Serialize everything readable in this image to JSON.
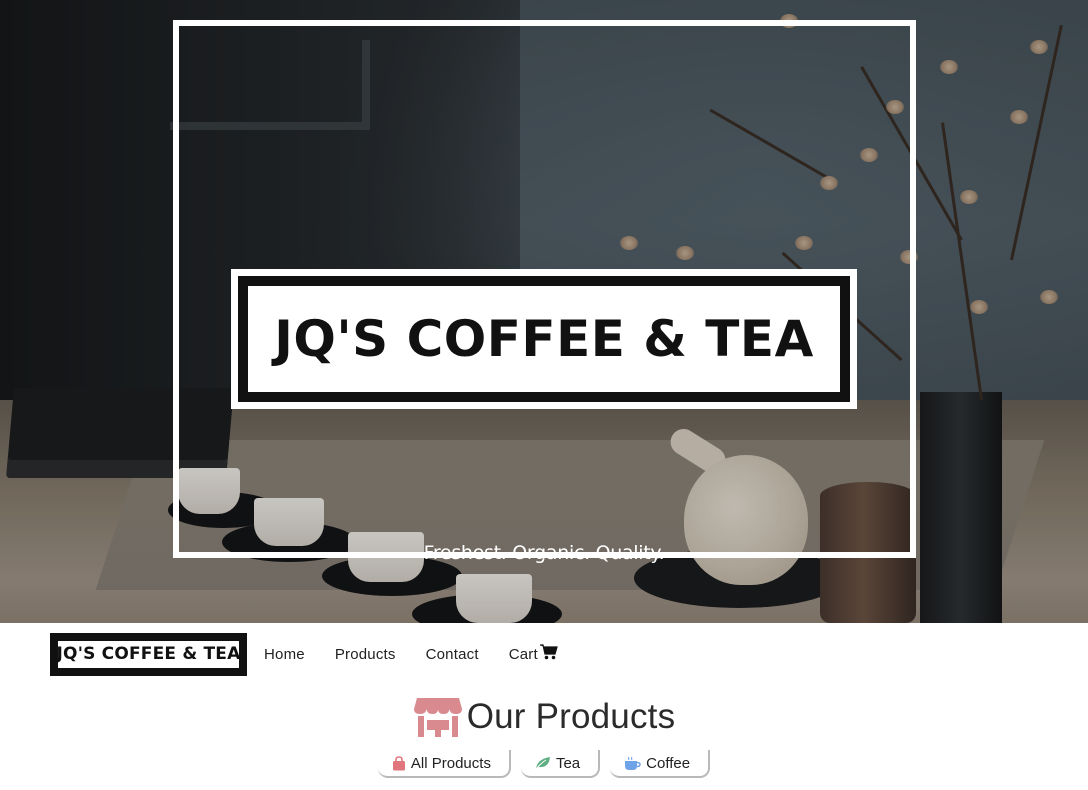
{
  "hero": {
    "title": "JQ'S COFFEE & TEA",
    "tagline": "Freshest. Organic. Quality."
  },
  "navbar": {
    "brand": "JQ'S COFFEE & TEA",
    "links": {
      "home": "Home",
      "products": "Products",
      "contact": "Contact",
      "cart": "Cart"
    },
    "cart_icon": "shopping-cart-icon"
  },
  "products": {
    "heading": "Our Products",
    "heading_icon": "store-icon",
    "filters": {
      "all": {
        "label": "All Products",
        "icon": "shopping-bag-icon",
        "color": "#e0757d"
      },
      "tea": {
        "label": "Tea",
        "icon": "leaf-icon",
        "color": "#5fae84"
      },
      "coffee": {
        "label": "Coffee",
        "icon": "coffee-cup-icon",
        "color": "#6fa3e8"
      }
    }
  },
  "colors": {
    "accent_store": "#d98a8f",
    "brand_black": "#111111",
    "text": "#222222"
  }
}
